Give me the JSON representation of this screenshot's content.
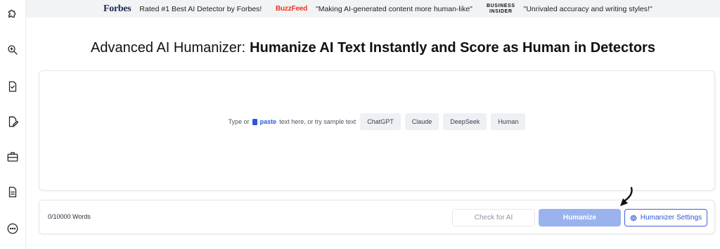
{
  "sidebar": {
    "icons": [
      {
        "name": "puzzle-icon"
      },
      {
        "name": "magnifier-icon"
      },
      {
        "name": "document-check-icon"
      },
      {
        "name": "document-edit-icon"
      },
      {
        "name": "briefcase-icon"
      },
      {
        "name": "document-lines-icon"
      },
      {
        "name": "more-icon"
      }
    ]
  },
  "banner": {
    "forbes_logo": "Forbes",
    "forbes_quote": "Rated #1 Best AI Detector by Forbes!",
    "buzzfeed_logo": "BuzzFeed",
    "buzzfeed_quote": "\"Making AI-generated content more human-like\"",
    "bi_logo_line1": "BUSINESS",
    "bi_logo_line2": "INSIDER",
    "bi_quote": "\"Unrivaled accuracy and writing styles!\""
  },
  "heading": {
    "lead": "Advanced AI Humanizer:",
    "strong": "Humanize AI Text Instantly and Score as Human in Detectors"
  },
  "editor": {
    "prompt_before": "Type or",
    "paste_label": "paste",
    "prompt_after": "text here, or try sample text",
    "samples": [
      "ChatGPT",
      "Claude",
      "DeepSeek",
      "Human"
    ]
  },
  "actions": {
    "word_count": "0/10000 Words",
    "check_label": "Check for AI",
    "humanize_label": "Humanize",
    "settings_label": "Humanizer Settings"
  },
  "colors": {
    "accent": "#2b57d9",
    "humanize_button": "#9ab3ef",
    "banner_bg": "#f2f3f5",
    "buzzfeed_red": "#ee3322"
  }
}
